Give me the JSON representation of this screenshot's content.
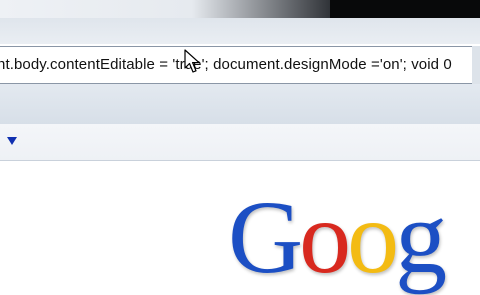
{
  "address_bar": {
    "text": "nt.body.contentEditable = 'true'; document.designMode ='on'; void 0"
  },
  "logo": {
    "letters": [
      "G",
      "o",
      "o",
      "g"
    ],
    "colors": [
      "#1c4fc4",
      "#d8291f",
      "#f3bb13",
      "#1c4fc4"
    ]
  },
  "icons": {
    "dropdown": "chevron-down-icon",
    "cursor": "mouse-pointer-icon"
  }
}
